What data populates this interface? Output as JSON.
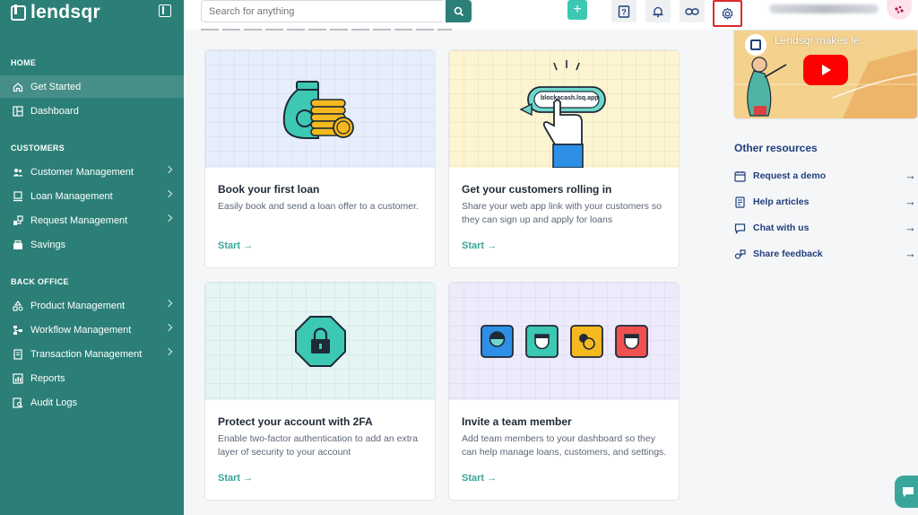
{
  "brand": {
    "name": "lendsqr"
  },
  "colors": {
    "sidebar": "#2b7f77",
    "accent": "#3aa59a",
    "primary_text": "#213f7d",
    "highlight": "#d92b2b"
  },
  "sidebar": {
    "sections": [
      {
        "heading": "HOME"
      },
      {
        "heading": "CUSTOMERS"
      },
      {
        "heading": "BACK OFFICE"
      }
    ],
    "items": [
      {
        "label": "Get Started",
        "icon": "home-icon",
        "active": true
      },
      {
        "label": "Dashboard",
        "icon": "dashboard-icon"
      },
      {
        "label": "Customer Management",
        "icon": "users-icon",
        "expandable": true
      },
      {
        "label": "Loan Management",
        "icon": "loan-icon",
        "expandable": true
      },
      {
        "label": "Request Management",
        "icon": "request-icon",
        "expandable": true
      },
      {
        "label": "Savings",
        "icon": "savings-icon"
      },
      {
        "label": "Product Management",
        "icon": "product-icon",
        "expandable": true
      },
      {
        "label": "Workflow Management",
        "icon": "workflow-icon",
        "expandable": true
      },
      {
        "label": "Transaction Management",
        "icon": "transaction-icon",
        "expandable": true
      },
      {
        "label": "Reports",
        "icon": "reports-icon"
      },
      {
        "label": "Audit Logs",
        "icon": "audit-icon"
      }
    ]
  },
  "topbar": {
    "search_placeholder": "Search for anything",
    "add_label": "+"
  },
  "cards": [
    {
      "title": "Book your first loan",
      "desc": "Easily book and send a loan offer to a customer.",
      "cta": "Start"
    },
    {
      "title": "Get your customers rolling in",
      "desc": "Share your web app link with your customers so they can sign up and apply for loans",
      "cta": "Start",
      "art_url": "blockacash.lsq.app"
    },
    {
      "title": "Protect your account with 2FA",
      "desc": "Enable two-factor authentication to add an extra layer of security to your account",
      "cta": "Start"
    },
    {
      "title": "Invite a team member",
      "desc": "Add team members to your dashboard so they can help manage loans, customers, and settings.",
      "cta": "Start"
    }
  ],
  "video": {
    "title": "Lendsqr makes le..."
  },
  "resources": {
    "heading": "Other resources",
    "items": [
      {
        "label": "Request a demo",
        "icon": "calendar-icon"
      },
      {
        "label": "Help articles",
        "icon": "article-icon"
      },
      {
        "label": "Chat with us",
        "icon": "chat-icon"
      },
      {
        "label": "Share feedback",
        "icon": "feedback-icon"
      }
    ]
  }
}
